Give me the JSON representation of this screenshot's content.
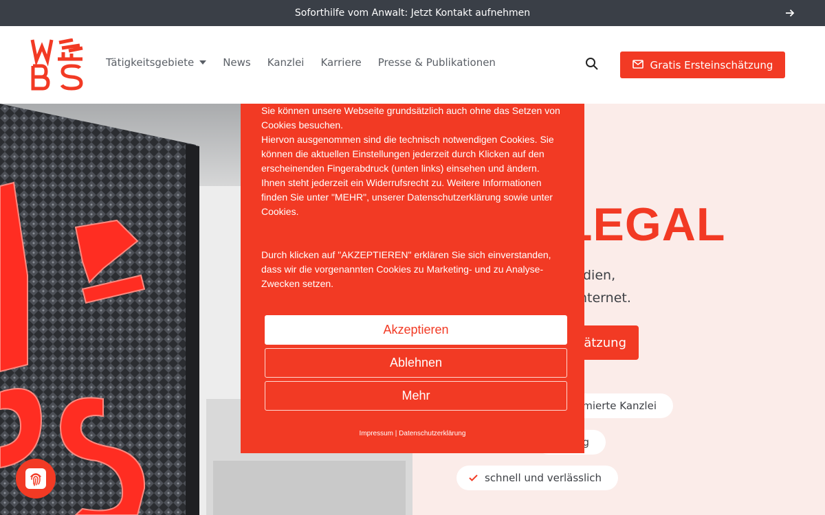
{
  "topbar": {
    "text": "Soforthilfe vom Anwalt: Jetzt Kontakt aufnehmen",
    "arrow_icon": "arrow-right-icon"
  },
  "header": {
    "nav": [
      {
        "label": "Tätigkeitsgebiete",
        "has_dropdown": true
      },
      {
        "label": "News"
      },
      {
        "label": "Kanzlei"
      },
      {
        "label": "Karriere"
      },
      {
        "label": "Presse & Publikationen"
      }
    ],
    "search_icon": "search-icon",
    "cta_label": "Gratis Ersteinschätzung",
    "cta_icon": "envelope-icon"
  },
  "hero": {
    "title_fragment": "LEGAL",
    "line1_fragment": "dien,",
    "line2_fragment": "nternet.",
    "button_fragment": "ätzung",
    "pills": [
      {
        "text": "mierte Kanzlei"
      },
      {
        "text": "g"
      },
      {
        "text": "schnell und verlässlich"
      }
    ]
  },
  "cookie": {
    "paragraph1": "Sie können unsere Webseite grundsätzlich auch ohne das Setzen von Cookies besuchen.\nHiervon ausgenommen sind die technisch notwendigen Cookies. Sie können die aktuellen Einstellungen jederzeit durch Klicken auf den erscheinenden Fingerabdruck (unten links) einsehen und ändern.\nIhnen steht jederzeit ein Widerrufsrecht zu. Weitere Informationen finden Sie unter \"MEHR\", unserer Datenschutzerklärung sowie unter Cookies.",
    "paragraph2": "Durch klicken auf \"AKZEPTIEREN\" erklären Sie sich einverstanden, dass wir die vorgenannten Cookies zu Marketing- und zu Analyse-Zwecken setzen.",
    "accept_label": "Akzeptieren",
    "decline_label": "Ablehnen",
    "more_label": "Mehr",
    "impressum_label": "Impressum",
    "separator": " | ",
    "privacy_label": "Datenschutzerklärung"
  },
  "colors": {
    "brand": "#f23a24",
    "topbar": "#3a3f47",
    "hero_bg": "#fbece9"
  }
}
